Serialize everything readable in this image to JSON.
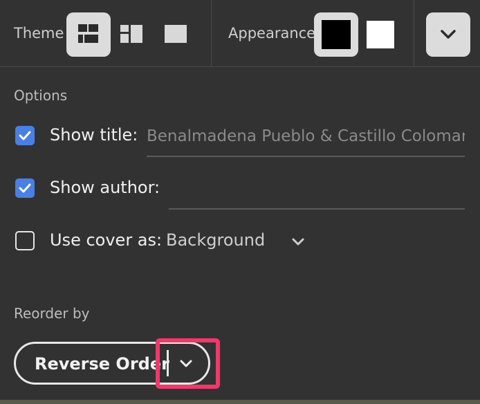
{
  "toolbar": {
    "theme_label": "Theme",
    "theme_buttons": [
      {
        "icon": "grid-layout-icon",
        "selected": true
      },
      {
        "icon": "columns-layout-icon",
        "selected": false
      },
      {
        "icon": "single-layout-icon",
        "selected": false
      }
    ],
    "appearance_label": "Appearance",
    "appearance_options": [
      {
        "icon": "dark-appearance-icon",
        "color": "#000000",
        "selected": true
      },
      {
        "icon": "light-appearance-icon",
        "color": "#ffffff",
        "selected": false
      }
    ],
    "more_icon": "chevron-down-icon"
  },
  "options": {
    "section_label": "Options",
    "show_title": {
      "label": "Show title:",
      "checked": true,
      "value": "Benalmadena Pueblo & Castillo Colomar"
    },
    "show_author": {
      "label": "Show author:",
      "checked": true,
      "value": ""
    },
    "use_cover": {
      "label": "Use cover as:",
      "checked": false,
      "selected": "Background"
    }
  },
  "reorder": {
    "section_label": "Reorder by",
    "button_label": "Reverse Order",
    "dropdown_icon": "chevron-down-icon"
  },
  "colors": {
    "background": "#323232",
    "checkbox_accent": "#4a7fe3",
    "highlight": "#f0386b"
  }
}
